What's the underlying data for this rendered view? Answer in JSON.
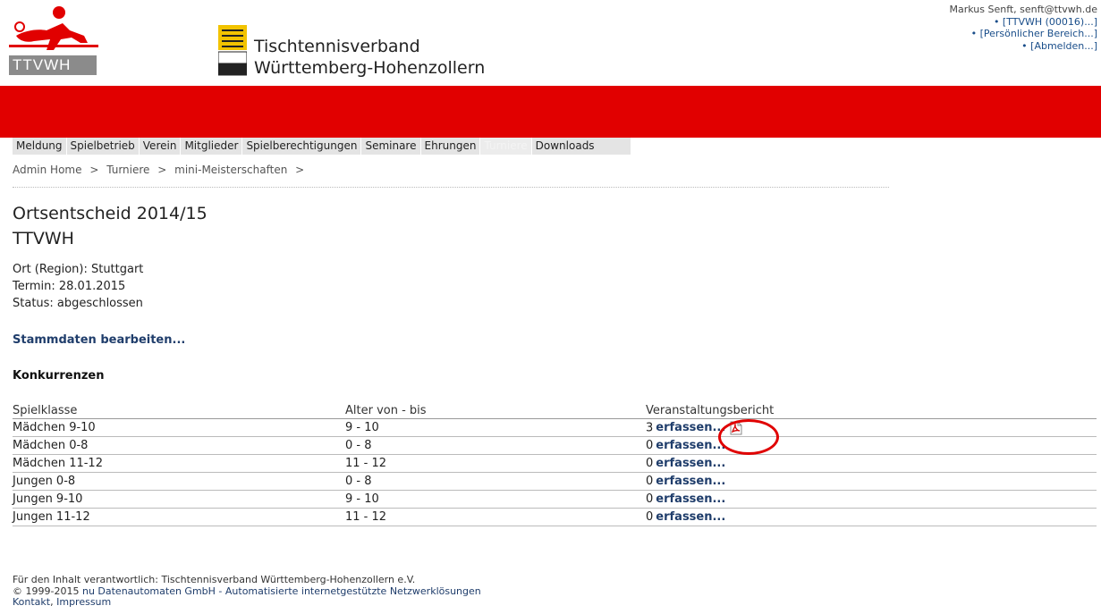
{
  "header": {
    "logo_text": "TTVWH",
    "federation_line1": "Tischtennisverband",
    "federation_line2": "Württemberg-Hohenzollern"
  },
  "user_box": {
    "user": "Markus Senft, senft@ttvwh.de",
    "links": [
      "• [TTVWH (00016)...]",
      "• [Persönlicher Bereich...]",
      "• [Abmelden...]"
    ]
  },
  "nav": {
    "items": [
      "Meldung",
      "Spielbetrieb",
      "Verein",
      "Mitglieder",
      "Spielberechtigungen",
      "Seminare",
      "Ehrungen",
      "Turniere",
      "Downloads"
    ],
    "active": "Turniere"
  },
  "breadcrumb": [
    "Admin Home",
    ">",
    "Turniere",
    ">",
    "mini-Meisterschaften",
    ">"
  ],
  "page": {
    "title": "Ortsentscheid 2014/15",
    "subtitle": "TTVWH",
    "ort": "Ort (Region): Stuttgart",
    "termin": "Termin: 28.01.2015",
    "status": "Status: abgeschlossen",
    "edit_link": "Stammdaten bearbeiten...",
    "section_title": "Konkurrenzen"
  },
  "table": {
    "headers": [
      "Spielklasse",
      "Alter von - bis",
      "Veranstaltungsbericht"
    ],
    "rows": [
      {
        "klasse": "Mädchen 9-10",
        "alter": "9 - 10",
        "count": "3",
        "action": "erfassen...",
        "pdf": true
      },
      {
        "klasse": "Mädchen 0-8",
        "alter": "0 - 8",
        "count": "0",
        "action": "erfassen...",
        "pdf": false
      },
      {
        "klasse": "Mädchen 11-12",
        "alter": "11 - 12",
        "count": "0",
        "action": "erfassen...",
        "pdf": false
      },
      {
        "klasse": "Jungen 0-8",
        "alter": "0 - 8",
        "count": "0",
        "action": "erfassen...",
        "pdf": false
      },
      {
        "klasse": "Jungen 9-10",
        "alter": "9 - 10",
        "count": "0",
        "action": "erfassen...",
        "pdf": false
      },
      {
        "klasse": "Jungen 11-12",
        "alter": "11 - 12",
        "count": "0",
        "action": "erfassen...",
        "pdf": false
      }
    ]
  },
  "footer": {
    "line1": "Für den Inhalt verantwortlich: Tischtennisverband Württemberg-Hohenzollern e.V.",
    "line2_prefix": "© 1999-2015",
    "line2_company": "nu Datenautomaten GmbH - Automatisierte internetgestützte Netzwerklösungen",
    "kontakt": "Kontakt",
    "impressum": "Impressum"
  },
  "colors": {
    "brand_red": "#e10000",
    "link_blue": "#1f3d6b",
    "highlight_circle": "#e00000"
  },
  "icons": [
    "ttvwh-logo-icon",
    "coat-of-arms-icon",
    "pdf-icon"
  ]
}
